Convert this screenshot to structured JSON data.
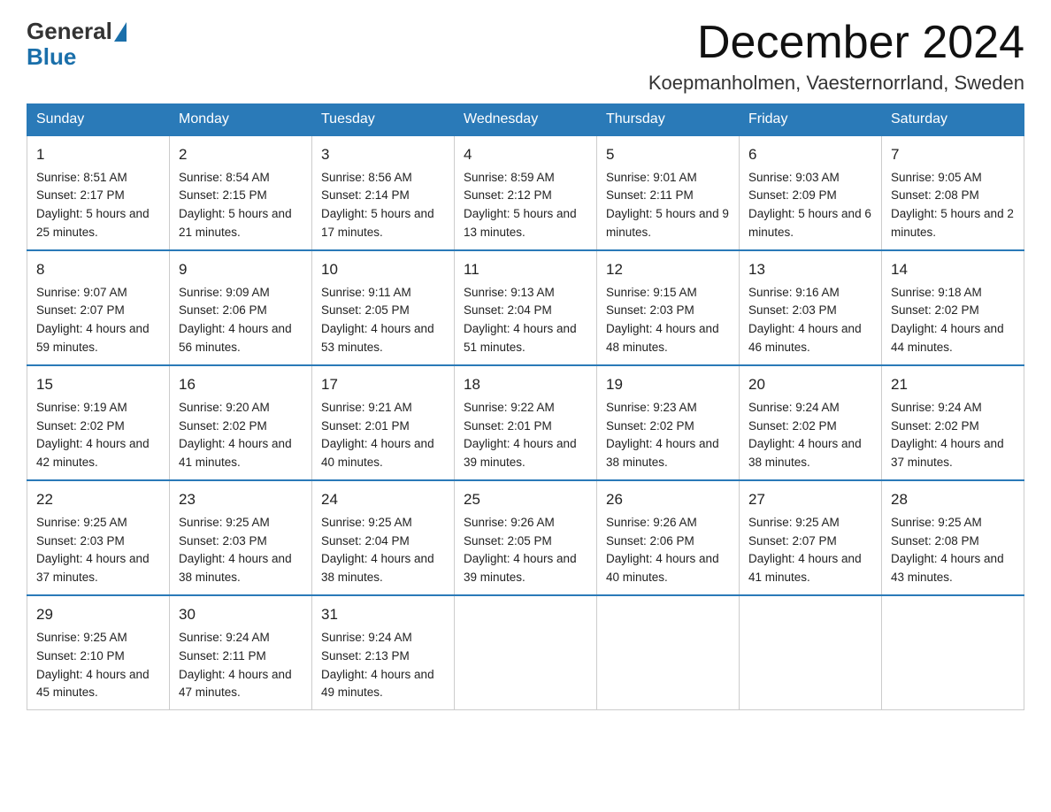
{
  "logo": {
    "general": "General",
    "blue": "Blue"
  },
  "title": "December 2024",
  "location": "Koepmanholmen, Vaesternorrland, Sweden",
  "days_header": [
    "Sunday",
    "Monday",
    "Tuesday",
    "Wednesday",
    "Thursday",
    "Friday",
    "Saturday"
  ],
  "weeks": [
    [
      {
        "day": "1",
        "sunrise": "8:51 AM",
        "sunset": "2:17 PM",
        "daylight": "5 hours and 25 minutes."
      },
      {
        "day": "2",
        "sunrise": "8:54 AM",
        "sunset": "2:15 PM",
        "daylight": "5 hours and 21 minutes."
      },
      {
        "day": "3",
        "sunrise": "8:56 AM",
        "sunset": "2:14 PM",
        "daylight": "5 hours and 17 minutes."
      },
      {
        "day": "4",
        "sunrise": "8:59 AM",
        "sunset": "2:12 PM",
        "daylight": "5 hours and 13 minutes."
      },
      {
        "day": "5",
        "sunrise": "9:01 AM",
        "sunset": "2:11 PM",
        "daylight": "5 hours and 9 minutes."
      },
      {
        "day": "6",
        "sunrise": "9:03 AM",
        "sunset": "2:09 PM",
        "daylight": "5 hours and 6 minutes."
      },
      {
        "day": "7",
        "sunrise": "9:05 AM",
        "sunset": "2:08 PM",
        "daylight": "5 hours and 2 minutes."
      }
    ],
    [
      {
        "day": "8",
        "sunrise": "9:07 AM",
        "sunset": "2:07 PM",
        "daylight": "4 hours and 59 minutes."
      },
      {
        "day": "9",
        "sunrise": "9:09 AM",
        "sunset": "2:06 PM",
        "daylight": "4 hours and 56 minutes."
      },
      {
        "day": "10",
        "sunrise": "9:11 AM",
        "sunset": "2:05 PM",
        "daylight": "4 hours and 53 minutes."
      },
      {
        "day": "11",
        "sunrise": "9:13 AM",
        "sunset": "2:04 PM",
        "daylight": "4 hours and 51 minutes."
      },
      {
        "day": "12",
        "sunrise": "9:15 AM",
        "sunset": "2:03 PM",
        "daylight": "4 hours and 48 minutes."
      },
      {
        "day": "13",
        "sunrise": "9:16 AM",
        "sunset": "2:03 PM",
        "daylight": "4 hours and 46 minutes."
      },
      {
        "day": "14",
        "sunrise": "9:18 AM",
        "sunset": "2:02 PM",
        "daylight": "4 hours and 44 minutes."
      }
    ],
    [
      {
        "day": "15",
        "sunrise": "9:19 AM",
        "sunset": "2:02 PM",
        "daylight": "4 hours and 42 minutes."
      },
      {
        "day": "16",
        "sunrise": "9:20 AM",
        "sunset": "2:02 PM",
        "daylight": "4 hours and 41 minutes."
      },
      {
        "day": "17",
        "sunrise": "9:21 AM",
        "sunset": "2:01 PM",
        "daylight": "4 hours and 40 minutes."
      },
      {
        "day": "18",
        "sunrise": "9:22 AM",
        "sunset": "2:01 PM",
        "daylight": "4 hours and 39 minutes."
      },
      {
        "day": "19",
        "sunrise": "9:23 AM",
        "sunset": "2:02 PM",
        "daylight": "4 hours and 38 minutes."
      },
      {
        "day": "20",
        "sunrise": "9:24 AM",
        "sunset": "2:02 PM",
        "daylight": "4 hours and 38 minutes."
      },
      {
        "day": "21",
        "sunrise": "9:24 AM",
        "sunset": "2:02 PM",
        "daylight": "4 hours and 37 minutes."
      }
    ],
    [
      {
        "day": "22",
        "sunrise": "9:25 AM",
        "sunset": "2:03 PM",
        "daylight": "4 hours and 37 minutes."
      },
      {
        "day": "23",
        "sunrise": "9:25 AM",
        "sunset": "2:03 PM",
        "daylight": "4 hours and 38 minutes."
      },
      {
        "day": "24",
        "sunrise": "9:25 AM",
        "sunset": "2:04 PM",
        "daylight": "4 hours and 38 minutes."
      },
      {
        "day": "25",
        "sunrise": "9:26 AM",
        "sunset": "2:05 PM",
        "daylight": "4 hours and 39 minutes."
      },
      {
        "day": "26",
        "sunrise": "9:26 AM",
        "sunset": "2:06 PM",
        "daylight": "4 hours and 40 minutes."
      },
      {
        "day": "27",
        "sunrise": "9:25 AM",
        "sunset": "2:07 PM",
        "daylight": "4 hours and 41 minutes."
      },
      {
        "day": "28",
        "sunrise": "9:25 AM",
        "sunset": "2:08 PM",
        "daylight": "4 hours and 43 minutes."
      }
    ],
    [
      {
        "day": "29",
        "sunrise": "9:25 AM",
        "sunset": "2:10 PM",
        "daylight": "4 hours and 45 minutes."
      },
      {
        "day": "30",
        "sunrise": "9:24 AM",
        "sunset": "2:11 PM",
        "daylight": "4 hours and 47 minutes."
      },
      {
        "day": "31",
        "sunrise": "9:24 AM",
        "sunset": "2:13 PM",
        "daylight": "4 hours and 49 minutes."
      },
      null,
      null,
      null,
      null
    ]
  ],
  "labels": {
    "sunrise": "Sunrise:",
    "sunset": "Sunset:",
    "daylight": "Daylight:"
  }
}
